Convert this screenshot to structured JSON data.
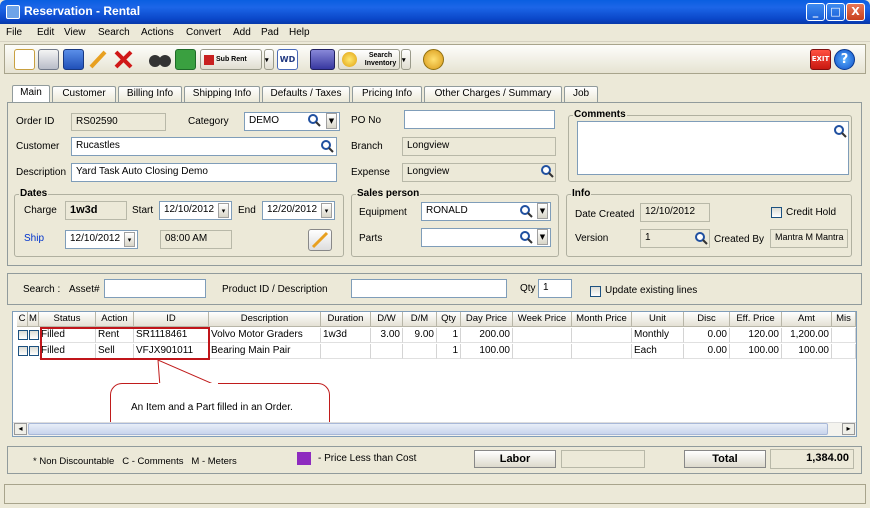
{
  "window": {
    "title": "Reservation - Rental",
    "minimize": "_",
    "maximize": "□",
    "close": "X"
  },
  "menu": [
    "File",
    "Edit",
    "View",
    "Search",
    "Actions",
    "Convert",
    "Add",
    "Pad",
    "Help"
  ],
  "toolbar": {
    "sub_rent": "Sub Rent",
    "search_inventory_1": "Search",
    "search_inventory_2": "Inventory",
    "exit": "EXIT",
    "help": "?"
  },
  "tabs": [
    "Main",
    "Customer",
    "Billing Info",
    "Shipping Info",
    "Defaults / Taxes",
    "Pricing Info",
    "Other Charges / Summary",
    "Job"
  ],
  "main": {
    "order_id_label": "Order ID",
    "order_id": "RS02590",
    "category_label": "Category",
    "category": "DEMO",
    "po_no_label": "PO No",
    "po_no": "",
    "customer_label": "Customer",
    "customer": "Rucastles",
    "branch_label": "Branch",
    "branch": "Longview",
    "description_label": "Description",
    "description": "Yard Task Auto Closing Demo",
    "expense_label": "Expense",
    "expense": "Longview",
    "comments_label": "Comments"
  },
  "dates": {
    "title": "Dates",
    "charge_label": "Charge",
    "charge": "1w3d",
    "start_label": "Start",
    "start": "12/10/2012",
    "end_label": "End",
    "end": "12/20/2012",
    "ship_label": "Ship",
    "ship_date": "12/10/2012",
    "ship_time": "08:00 AM"
  },
  "sales": {
    "title": "Sales person",
    "equipment_label": "Equipment",
    "equipment": "RONALD",
    "parts_label": "Parts",
    "parts": ""
  },
  "info": {
    "title": "Info",
    "credit_hold_label": "Credit Hold",
    "date_created_label": "Date Created",
    "date_created": "12/10/2012",
    "version_label": "Version",
    "version": "1",
    "created_by_label": "Created By",
    "created_by": "Mantra M Mantra"
  },
  "search": {
    "search_label": "Search :",
    "asset_label": "Asset#",
    "asset": "",
    "product_label": "Product ID / Description",
    "product": "",
    "qty_label": "Qty",
    "qty": "1",
    "update_label": "Update existing lines"
  },
  "grid": {
    "columns": [
      "C",
      "M",
      "Status",
      "Action",
      "ID",
      "Description",
      "Duration",
      "D/W",
      "D/M",
      "Qty",
      "Day Price",
      "Week Price",
      "Month Price",
      "Unit",
      "Disc",
      "Eff. Price",
      "Amt",
      "Mis"
    ],
    "rows": [
      [
        "",
        "",
        "Filled",
        "Rent",
        "SR1118461",
        "Volvo Motor Graders",
        "1w3d",
        "3.00",
        "9.00",
        "1",
        "200.00",
        "",
        "",
        "Monthly",
        "0.00",
        "120.00",
        "1,200.00",
        ""
      ],
      [
        "",
        "",
        "Filled",
        "Sell",
        "VFJX901011",
        "Bearing Main Pair",
        "",
        "",
        "",
        "1",
        "100.00",
        "",
        "",
        "Each",
        "0.00",
        "100.00",
        "100.00",
        ""
      ]
    ]
  },
  "callout": {
    "text": "An Item and a Part filled in an Order."
  },
  "footer": {
    "legend": "* Non Discountable   C - Comments   M - Meters",
    "price_less_label": "- Price Less than Cost",
    "labor_label": "Labor",
    "labor": "",
    "total_label": "Total",
    "total": "1,384.00"
  },
  "colors": {
    "title_bar": "#0a5ee0",
    "highlight_box": "#c0151a",
    "price_less_swatch": "#8e2bbf",
    "link_blue": "#0033cc"
  }
}
